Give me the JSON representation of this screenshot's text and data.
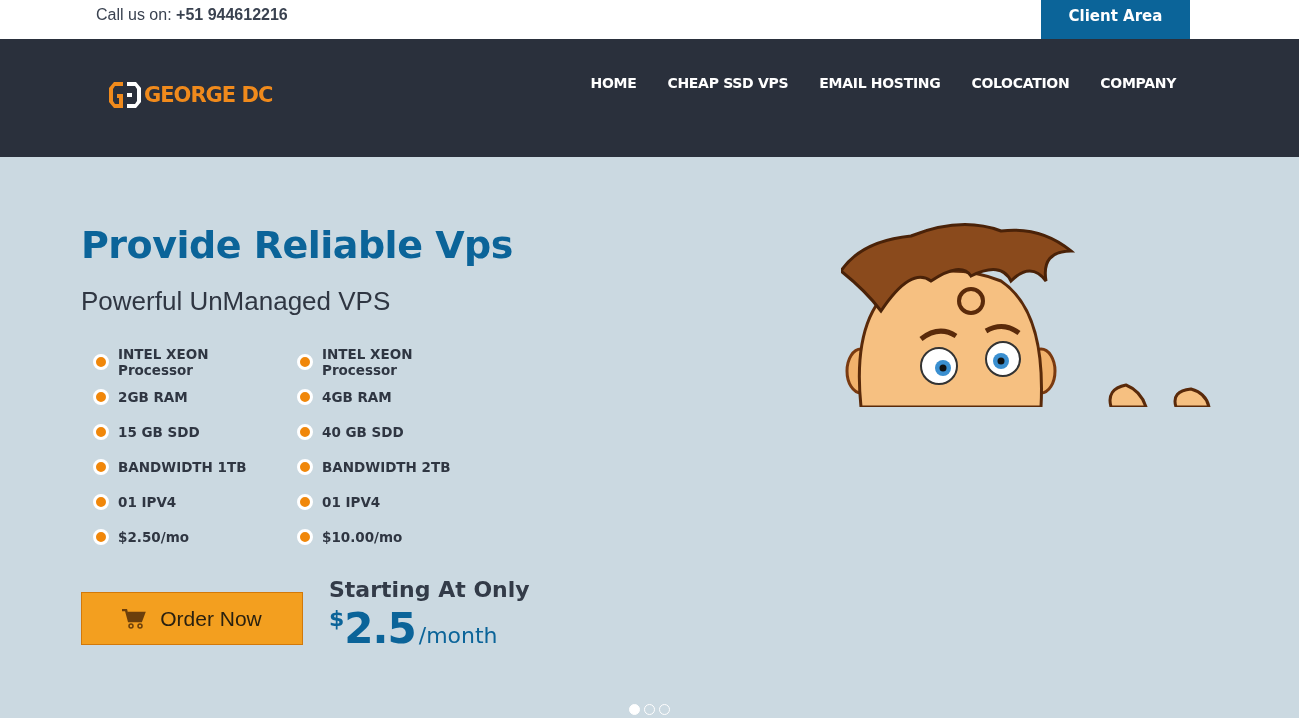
{
  "top_bar": {
    "call_label": "Call us on:",
    "phone": "+51 944612216",
    "client_button": "Client Area"
  },
  "header": {
    "logo_text": "GEORGE DC",
    "nav": [
      {
        "label": "HOME"
      },
      {
        "label": "CHEAP SSD VPS"
      },
      {
        "label": "EMAIL HOSTING"
      },
      {
        "label": "COLOCATION"
      },
      {
        "label": "COMPANY"
      }
    ]
  },
  "hero": {
    "title": "Provide Reliable Vps",
    "subtitle": "Powerful UnManaged VPS",
    "plans": [
      {
        "features": [
          "INTEL XEON Processor",
          "2GB RAM",
          "15 GB SDD",
          "BANDWIDTH 1TB",
          "01 IPV4",
          "$2.50/mo"
        ]
      },
      {
        "features": [
          "INTEL XEON Processor",
          "4GB RAM",
          "40 GB SDD",
          "BANDWIDTH 2TB",
          "01 IPV4",
          "$10.00/mo"
        ]
      }
    ],
    "order_button": "Order Now",
    "starting_label": "Starting At Only",
    "currency": "$",
    "amount": "2.5",
    "period": "/month",
    "slides": [
      {
        "selected": true
      },
      {
        "selected": false
      },
      {
        "selected": false
      }
    ]
  }
}
